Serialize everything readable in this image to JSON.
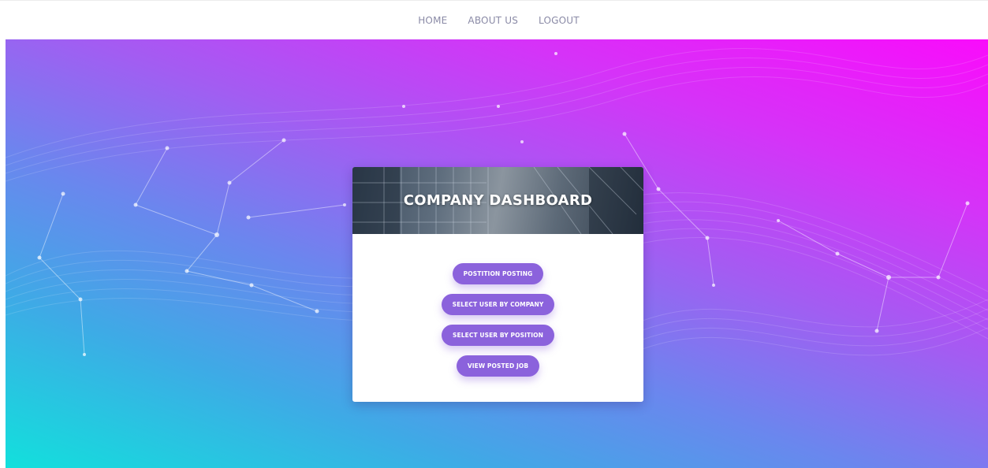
{
  "nav": {
    "items": [
      {
        "label": "HOME"
      },
      {
        "label": "ABOUT US"
      },
      {
        "label": "LOGOUT"
      }
    ]
  },
  "card": {
    "title": "COMPANY DASHBOARD",
    "buttons": [
      {
        "label": "POSTITION POSTING"
      },
      {
        "label": "SELECT USER BY COMPANY"
      },
      {
        "label": "SELECT USER BY POSITION"
      },
      {
        "label": "VIEW POSTED JOB"
      }
    ]
  },
  "colors": {
    "button": "#8b62dc",
    "gradient_start": "#12e0dc",
    "gradient_end": "#f90cfb",
    "nav_text": "#8a8aa6"
  }
}
